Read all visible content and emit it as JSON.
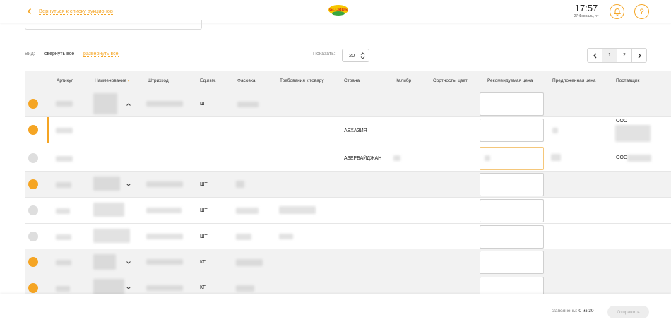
{
  "header": {
    "back_label": "Вернуться к списку аукционов",
    "logo_text": "GLOBUS",
    "time": "17:57",
    "date": "27 Февраль, чт",
    "help_label": "?"
  },
  "view": {
    "label": "Вид:",
    "collapse_all": "свернуть все",
    "expand_all": "развернуть все",
    "show_label": "Показать:",
    "page_size": "20"
  },
  "pager": {
    "page1": "1",
    "page2": "2"
  },
  "table": {
    "columns": [
      "Артикул",
      "Наименование",
      "Штрихкод",
      "Ед.изм.",
      "Фасовка",
      "Требования к товару",
      "Страна",
      "Калибр",
      "Сортность, цвет",
      "Рекомендуемая цена",
      "Предложенная цена",
      "Поставщик"
    ],
    "rows": [
      {
        "unit": "ШТ",
        "country": "",
        "supplier": ""
      },
      {
        "unit": "",
        "country": "АБХАЗИЯ",
        "supplier": "ООО"
      },
      {
        "unit": "",
        "country": "АЗЕРБАЙДЖАН",
        "supplier": "ООО"
      },
      {
        "unit": "ШТ",
        "country": "",
        "supplier": ""
      },
      {
        "unit": "ШТ",
        "country": "",
        "supplier": ""
      },
      {
        "unit": "ШТ",
        "country": "",
        "supplier": ""
      },
      {
        "unit": "КГ",
        "country": "",
        "supplier": ""
      },
      {
        "unit": "КГ",
        "country": "",
        "supplier": ""
      }
    ]
  },
  "footer": {
    "filled_label": "Заполнены:",
    "filled_value": "0 из 30",
    "send_label": "Отправить"
  },
  "colors": {
    "accent": "#f5a524",
    "row_grey": "#f2f2f2"
  }
}
